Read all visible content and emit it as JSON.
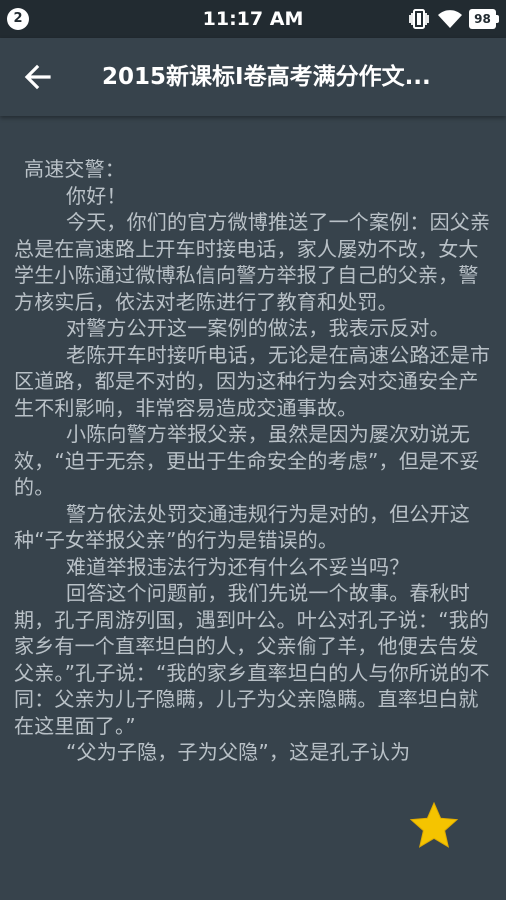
{
  "status_bar": {
    "notification_count": "2",
    "time": "11:17 AM",
    "battery_level": "98",
    "icons": [
      "vibrate-icon",
      "wifi-icon",
      "battery-icon"
    ]
  },
  "app_bar": {
    "back_icon": "arrow-left-icon",
    "title": "2015新课标I卷高考满分作文..."
  },
  "article": {
    "paragraphs": [
      "高速交警：",
      "你好！",
      "今天，你们的官方微博推送了一个案例：因父亲总是在高速路上开车时接电话，家人屡劝不改，女大学生小陈通过微博私信向警方举报了自己的父亲，警方核实后，依法对老陈进行了教育和处罚。",
      "对警方公开这一案例的做法，我表示反对。",
      "老陈开车时接听电话，无论是在高速公路还是市区道路，都是不对的，因为这种行为会对交通安全产生不利影响，非常容易造成交通事故。",
      "小陈向警方举报父亲，虽然是因为屡次劝说无效，“迫于无奈，更出于生命安全的考虑”，但是不妥的。",
      "警方依法处罚交通违规行为是对的，但公开这种“子女举报父亲”的行为是错误的。",
      "难道举报违法行为还有什么不妥当吗？",
      "回答这个问题前，我们先说一个故事。春秋时期，孔子周游列国，遇到叶公。叶公对孔子说：“我的家乡有一个直率坦白的人，父亲偷了羊，他便去告发父亲。”孔子说：“我的家乡直率坦白的人与你所说的不同：父亲为儿子隐瞒，儿子为父亲隐瞒。直率坦白就在这里面了。”",
      "“父为子隐，子为父隐”，这是孔子认为"
    ]
  },
  "floating_action": {
    "icon": "star-icon",
    "color": "#f5c400"
  },
  "colors": {
    "status_bar": "#222b31",
    "background": "#37434c",
    "text": "#b9c1c7",
    "title": "#ffffff"
  }
}
